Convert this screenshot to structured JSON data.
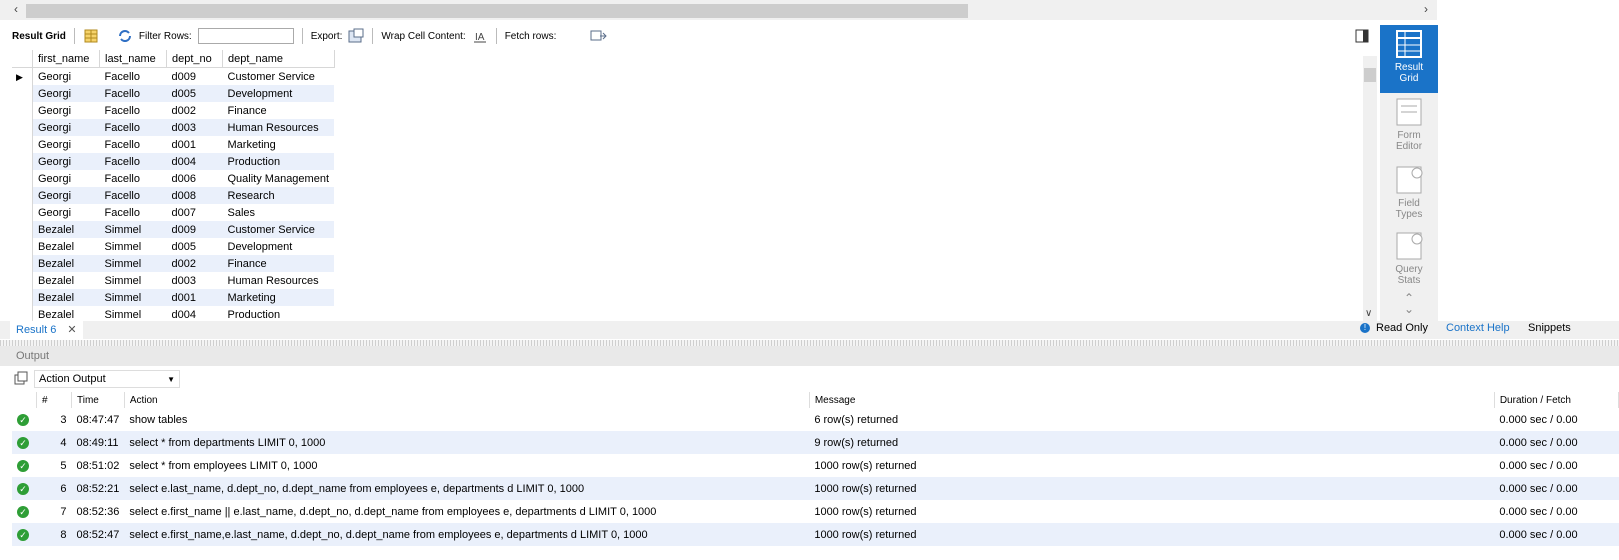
{
  "toolbar": {
    "result_grid": "Result Grid",
    "filter_rows": "Filter Rows:",
    "filter_value": "",
    "export": "Export:",
    "wrap_cell": "Wrap Cell Content:",
    "fetch_rows": "Fetch rows:"
  },
  "grid": {
    "columns": [
      "first_name",
      "last_name",
      "dept_no",
      "dept_name"
    ],
    "rows": [
      [
        "Georgi",
        "Facello",
        "d009",
        "Customer Service"
      ],
      [
        "Georgi",
        "Facello",
        "d005",
        "Development"
      ],
      [
        "Georgi",
        "Facello",
        "d002",
        "Finance"
      ],
      [
        "Georgi",
        "Facello",
        "d003",
        "Human Resources"
      ],
      [
        "Georgi",
        "Facello",
        "d001",
        "Marketing"
      ],
      [
        "Georgi",
        "Facello",
        "d004",
        "Production"
      ],
      [
        "Georgi",
        "Facello",
        "d006",
        "Quality Management"
      ],
      [
        "Georgi",
        "Facello",
        "d008",
        "Research"
      ],
      [
        "Georgi",
        "Facello",
        "d007",
        "Sales"
      ],
      [
        "Bezalel",
        "Simmel",
        "d009",
        "Customer Service"
      ],
      [
        "Bezalel",
        "Simmel",
        "d005",
        "Development"
      ],
      [
        "Bezalel",
        "Simmel",
        "d002",
        "Finance"
      ],
      [
        "Bezalel",
        "Simmel",
        "d003",
        "Human Resources"
      ],
      [
        "Bezalel",
        "Simmel",
        "d001",
        "Marketing"
      ],
      [
        "Bezalel",
        "Simmel",
        "d004",
        "Production"
      ]
    ]
  },
  "side": {
    "result_grid": "Result Grid",
    "form_editor": "Form Editor",
    "field_types": "Field Types",
    "query_stats": "Query Stats"
  },
  "tabs": {
    "result": "Result 6",
    "read_only": "Read Only",
    "context_help": "Context Help",
    "snippets": "Snippets"
  },
  "output": {
    "label": "Output",
    "selector": "Action Output",
    "columns": [
      "#",
      "Time",
      "Action",
      "Message",
      "Duration / Fetch"
    ],
    "rows": [
      [
        "3",
        "08:47:47",
        "show tables",
        "6 row(s) returned",
        "0.000 sec / 0.00"
      ],
      [
        "4",
        "08:49:11",
        "select * from departments LIMIT 0, 1000",
        "9 row(s) returned",
        "0.000 sec / 0.00"
      ],
      [
        "5",
        "08:51:02",
        "select * from employees LIMIT 0, 1000",
        "1000 row(s) returned",
        "0.000 sec / 0.00"
      ],
      [
        "6",
        "08:52:21",
        "select e.last_name, d.dept_no, d.dept_name from employees e, departments d LIMIT 0, 1000",
        "1000 row(s) returned",
        "0.000 sec / 0.00"
      ],
      [
        "7",
        "08:52:36",
        "select e.first_name || e.last_name, d.dept_no, d.dept_name from employees e, departments d LIMIT 0, 1000",
        "1000 row(s) returned",
        "0.000 sec / 0.00"
      ],
      [
        "8",
        "08:52:47",
        "select e.first_name,e.last_name, d.dept_no, d.dept_name from employees e, departments d LIMIT 0, 1000",
        "1000 row(s) returned",
        "0.000 sec / 0.00"
      ]
    ]
  },
  "colors": {
    "accent": "#1a73c8",
    "alt_row": "#eaf0fb",
    "ok": "#2e9e36"
  }
}
